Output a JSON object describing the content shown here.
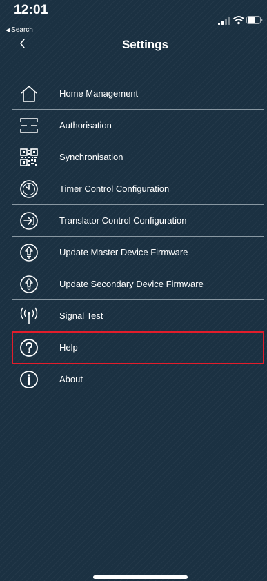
{
  "status_bar": {
    "time": "12:01",
    "back_app": "Search"
  },
  "nav": {
    "title": "Settings",
    "back_icon": "chevron-left-icon"
  },
  "menu": {
    "items": [
      {
        "label": "Home Management",
        "icon": "home-icon"
      },
      {
        "label": "Authorisation",
        "icon": "scan-frame-icon"
      },
      {
        "label": "Synchronisation",
        "icon": "qr-code-icon"
      },
      {
        "label": "Timer Control Configuration",
        "icon": "clock-icon"
      },
      {
        "label": "Translator Control Configuration",
        "icon": "translator-icon"
      },
      {
        "label": "Update Master Device Firmware",
        "icon": "bulb-upload-icon"
      },
      {
        "label": "Update Secondary Device Firmware",
        "icon": "bulb-upload-icon"
      },
      {
        "label": "Signal Test",
        "icon": "antenna-icon"
      },
      {
        "label": "Help",
        "icon": "question-icon"
      },
      {
        "label": "About",
        "icon": "info-icon"
      }
    ],
    "highlighted_item": "Help"
  },
  "colors": {
    "background": "#1b3142",
    "text": "#ffffff",
    "divider": "#e1ebf0",
    "highlight_border": "#e21d2b"
  }
}
